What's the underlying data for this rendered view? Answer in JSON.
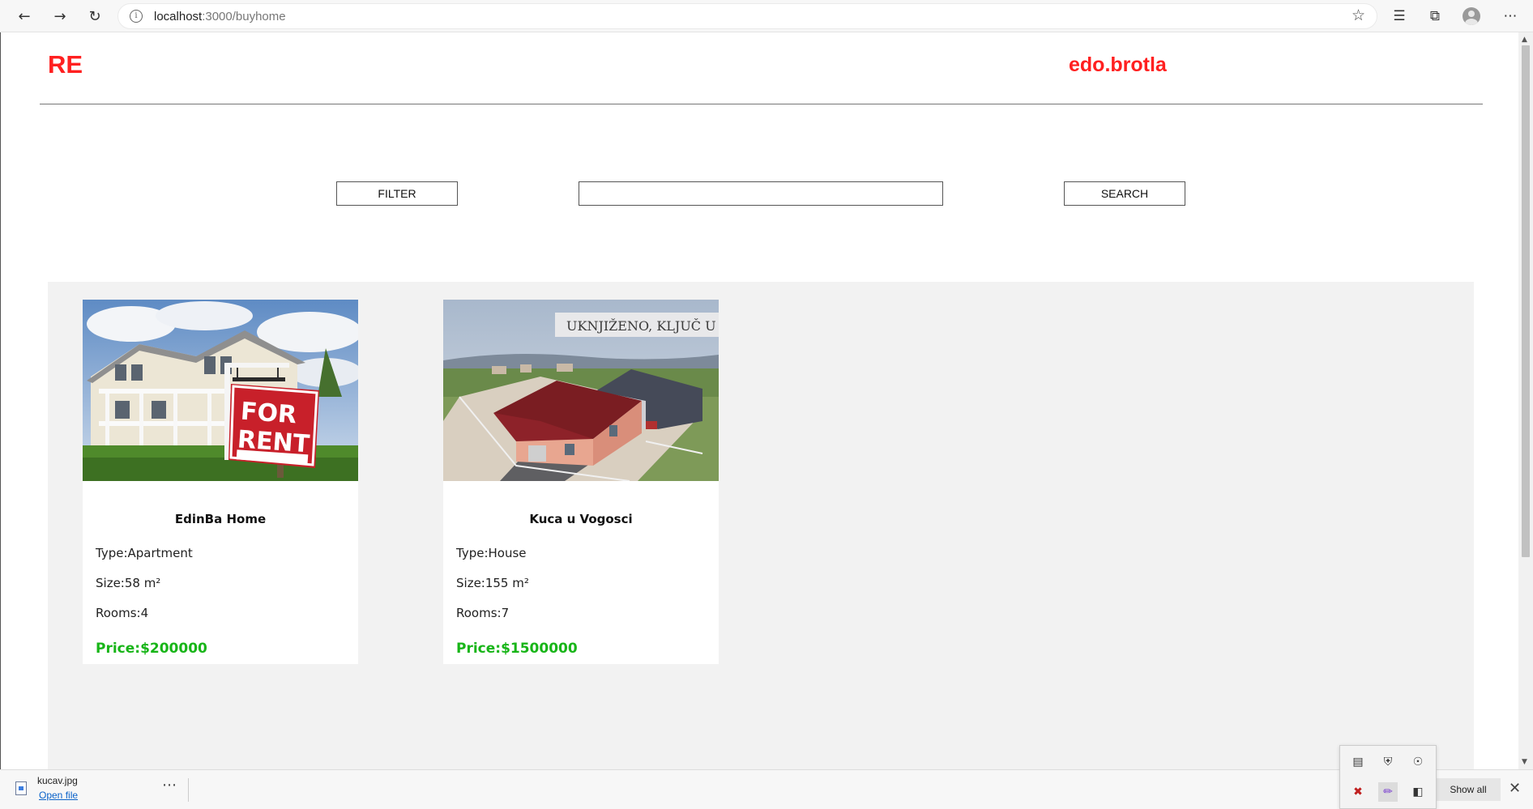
{
  "browser": {
    "url_host": "localhost",
    "url_path": ":3000/buyhome"
  },
  "header": {
    "logo": "RE",
    "username": "edo.brotla"
  },
  "controls": {
    "filter_label": "FILTER",
    "search_label": "SEARCH",
    "search_value": ""
  },
  "listings": [
    {
      "title": "EdinBa Home",
      "type": "Type:Apartment",
      "size": "Size:58 m²",
      "rooms": "Rooms:4",
      "price": "Price:$200000",
      "image_text": "FOR RENT"
    },
    {
      "title": "Kuca u Vogosci",
      "type": "Type:House",
      "size": "Size:155 m²",
      "rooms": "Rooms:7",
      "price": "Price:$1500000",
      "image_text": "UKNJIŽENO, KLJUČ U RUKE"
    }
  ],
  "download_shelf": {
    "file_name": "kucav.jpg",
    "open_file": "Open file",
    "show_all": "Show all"
  },
  "colors": {
    "brand_red": "#ff2020",
    "price_green": "#18b518",
    "listing_bg": "#f2f2f2"
  }
}
